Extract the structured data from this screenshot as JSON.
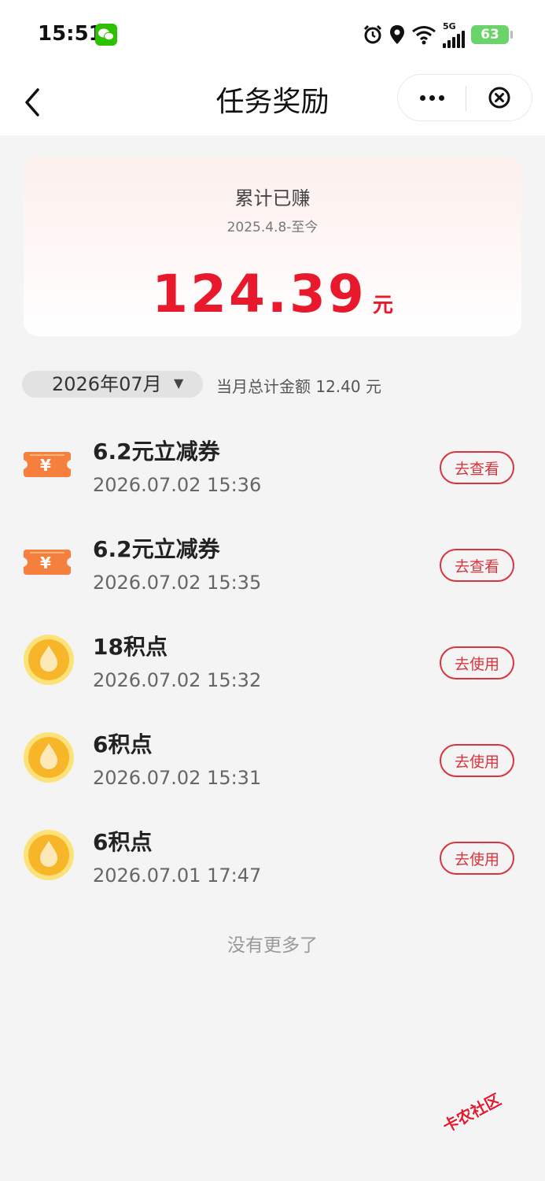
{
  "status_bar": {
    "time": "15:51",
    "network": "5G",
    "battery": "63"
  },
  "nav": {
    "title": "任务奖励"
  },
  "summary": {
    "title": "累计已赚",
    "date_range": "2025.4.8-至今",
    "amount": "124.39",
    "unit": "元"
  },
  "filter": {
    "month": "2026年07月",
    "total_label": "当月总计金额 12.40 元"
  },
  "rewards": [
    {
      "title": "6.2元立减券",
      "time": "2026.07.02 15:36",
      "action": "去查看",
      "icon": "coupon-icon"
    },
    {
      "title": "6.2元立减券",
      "time": "2026.07.02 15:35",
      "action": "去查看",
      "icon": "coupon-icon"
    },
    {
      "title": "18积点",
      "time": "2026.07.02 15:32",
      "action": "去使用",
      "icon": "points-icon"
    },
    {
      "title": "6积点",
      "time": "2026.07.02 15:31",
      "action": "去使用",
      "icon": "points-icon"
    },
    {
      "title": "6积点",
      "time": "2026.07.01 17:47",
      "action": "去使用",
      "icon": "points-icon"
    }
  ],
  "footer": {
    "no_more": "没有更多了"
  },
  "watermark": "卡农社区",
  "colors": {
    "accent_red": "#e8192c",
    "button_red": "#d9343d",
    "coupon_orange": "#f57f3c",
    "points_gold": "#f7b52a",
    "background": "#f4f4f4"
  }
}
